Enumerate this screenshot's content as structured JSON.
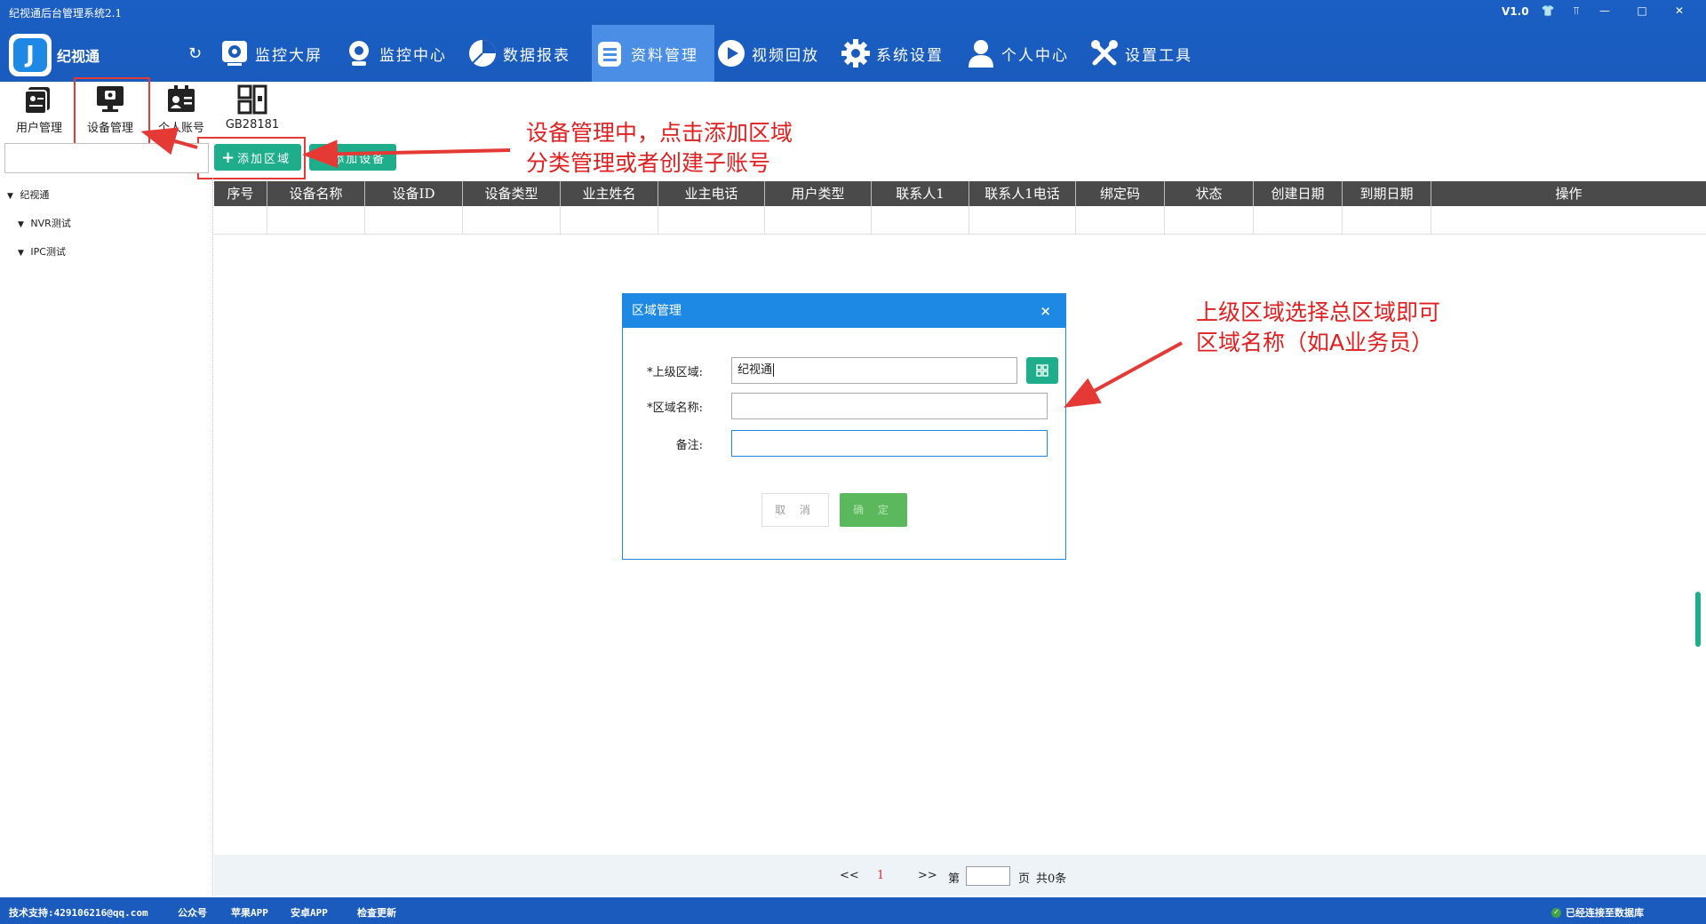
{
  "window": {
    "title": "纪视通后台管理系统2.1",
    "version": "V1.0"
  },
  "brand": {
    "name": "纪视通"
  },
  "nav": {
    "items": [
      {
        "label": "监控大屏",
        "icon": "monitor-screen-icon"
      },
      {
        "label": "监控中心",
        "icon": "camera-icon"
      },
      {
        "label": "数据报表",
        "icon": "pie-chart-icon"
      },
      {
        "label": "资料管理",
        "icon": "document-icon"
      },
      {
        "label": "视频回放",
        "icon": "play-icon"
      },
      {
        "label": "系统设置",
        "icon": "gear-icon"
      },
      {
        "label": "个人中心",
        "icon": "user-icon"
      },
      {
        "label": "设置工具",
        "icon": "tools-icon"
      }
    ],
    "active": "资料管理"
  },
  "subtoolbar": {
    "items": [
      {
        "label": "用户管理"
      },
      {
        "label": "设备管理"
      },
      {
        "label": "个人账号"
      },
      {
        "label": "GB28181"
      }
    ]
  },
  "actions": {
    "add_area": "添加区域",
    "add_device": "添加设备"
  },
  "tree": {
    "root": "纪视通",
    "children": [
      "NVR测试",
      "IPC测试"
    ]
  },
  "table": {
    "columns": [
      "序号",
      "设备名称",
      "设备ID",
      "设备类型",
      "业主姓名",
      "业主电话",
      "用户类型",
      "联系人1",
      "联系人1电话",
      "绑定码",
      "状态",
      "创建日期",
      "到期日期",
      "操作"
    ]
  },
  "pager": {
    "prev": "<<",
    "current": "1",
    "next": ">>",
    "page_prefix": "第",
    "page_suffix": "页",
    "total": "共0条"
  },
  "dialog": {
    "title": "区域管理",
    "close": "×",
    "parent_label": "*上级区域:",
    "parent_value": "纪视通",
    "name_label": "*区域名称:",
    "name_value": "",
    "remark_label": "备注:",
    "remark_value": "",
    "cancel": "取 消",
    "ok": "确 定"
  },
  "annotations": {
    "top_line1": "设备管理中，点击添加区域",
    "top_line2": "分类管理或者创建子账号",
    "right_line1": "上级区域选择总区域即可",
    "right_line2": "区域名称（如A业务员）"
  },
  "statusbar": {
    "support": "技术支持:429106216@qq.com",
    "wechat": "公众号",
    "apple": "苹果APP",
    "android": "安卓APP",
    "update": "检查更新",
    "db_status": "已经连接至数据库"
  },
  "colors": {
    "nav_blue": "#1a5bbd",
    "green": "#1fae8c",
    "dialog_blue": "#1e88e5",
    "annotation_red": "#e02020"
  }
}
